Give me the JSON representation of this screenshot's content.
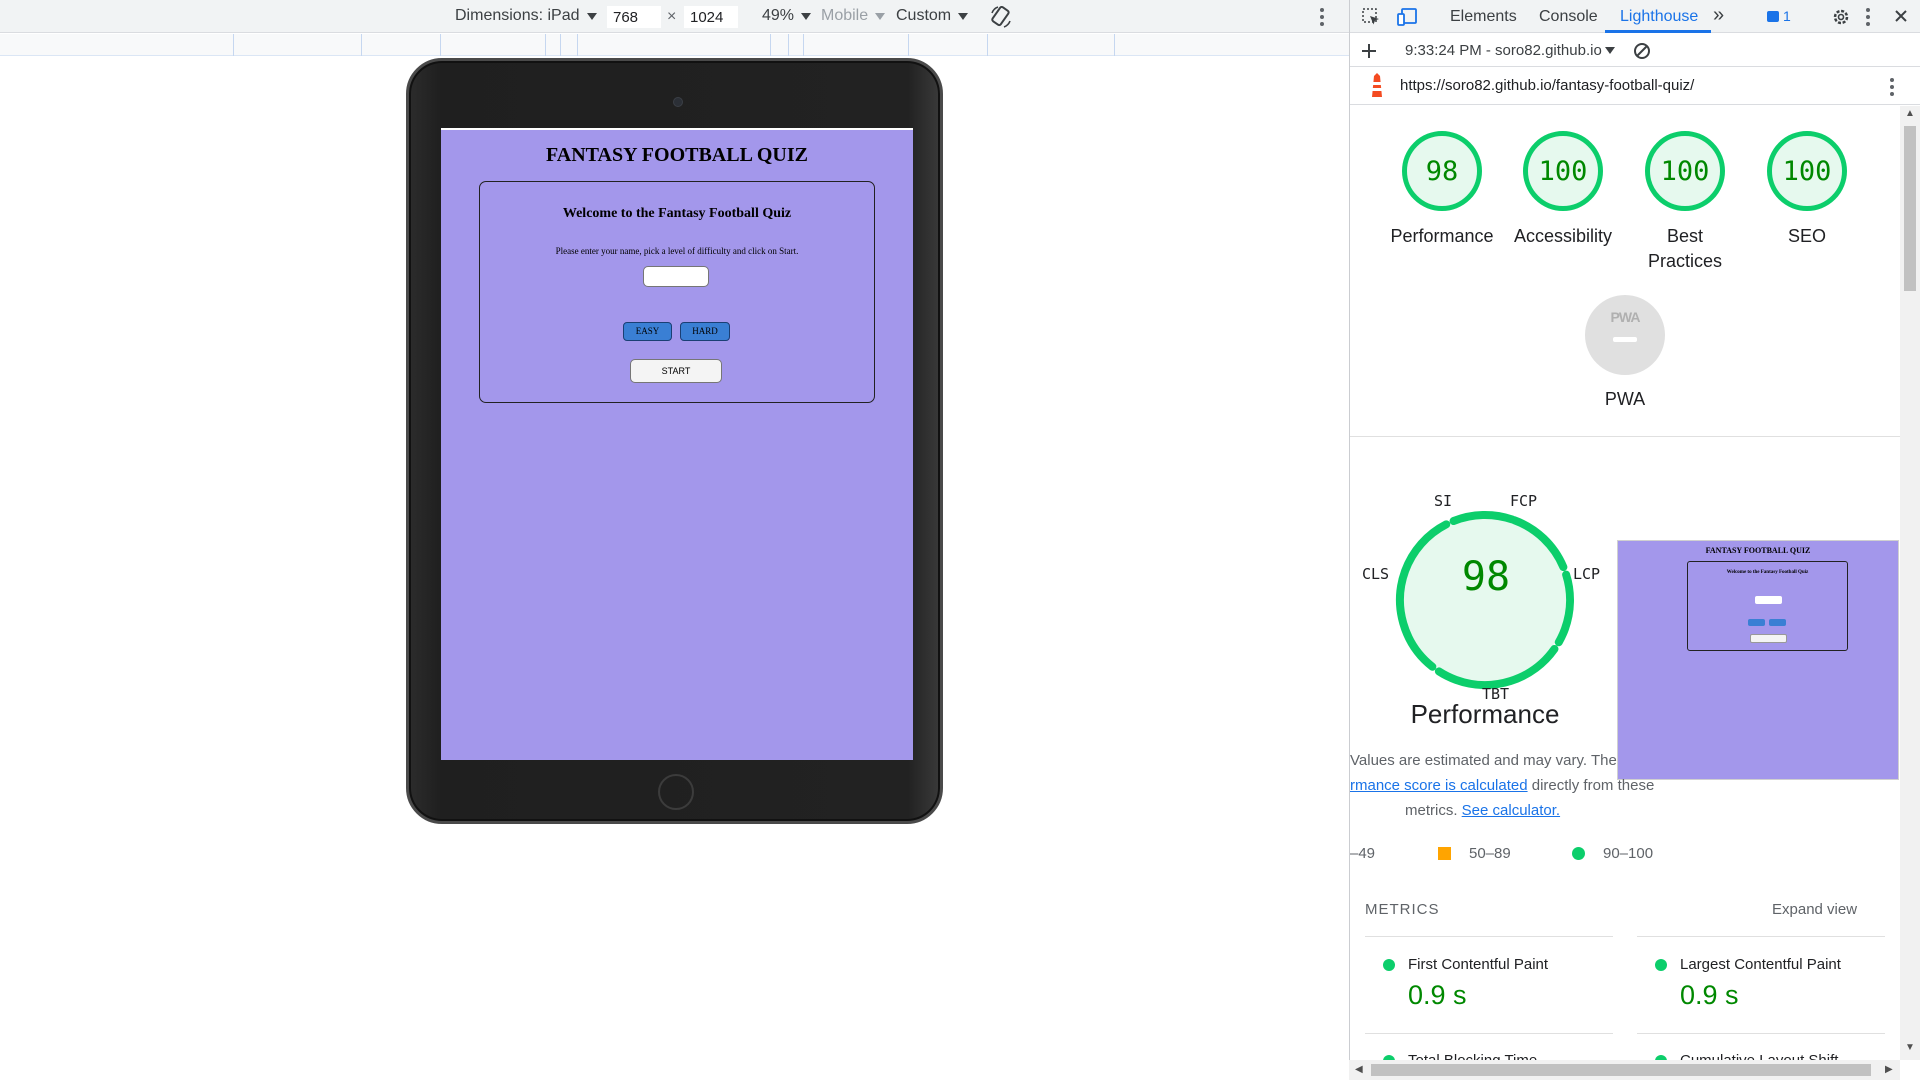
{
  "toolbar": {
    "dimensions_label": "Dimensions: iPad",
    "width": "768",
    "height": "1024",
    "times": "×",
    "zoom": "49%",
    "mode": "Mobile",
    "throttle": "Custom"
  },
  "ipad": {
    "quiz_title": "FANTASY FOOTBALL QUIZ",
    "welcome": "Welcome to the Fantasy Football Quiz",
    "instructions": "Please enter your name, pick a level of difficulty and click on Start.",
    "easy": "EASY",
    "hard": "HARD",
    "start": "START",
    "bg_color": "#a397eb"
  },
  "devtools": {
    "tabs": [
      "Elements",
      "Console",
      "Lighthouse"
    ],
    "active_tab": "Lighthouse",
    "issues_count": "1",
    "report_time": "9:33:24 PM - soro82.github.io",
    "url": "https://soro82.github.io/fantasy-football-quiz/"
  },
  "scores": {
    "performance": {
      "value": "98",
      "label": "Performance"
    },
    "accessibility": {
      "value": "100",
      "label": "Accessibility"
    },
    "best_practices": {
      "value": "100",
      "label1": "Best",
      "label2": "Practices"
    },
    "seo": {
      "value": "100",
      "label": "SEO"
    },
    "pwa": {
      "badge": "PWA",
      "label": "PWA"
    }
  },
  "perf_section": {
    "score": "98",
    "title": "Performance",
    "gauge_labels": {
      "si": "SI",
      "fcp": "FCP",
      "cls": "CLS",
      "lcp": "LCP",
      "tbt": "TBT"
    },
    "thumb_title": "FANTASY FOOTBALL QUIZ",
    "thumb_welcome": "Welcome to the Fantasy Football Quiz",
    "calc_line1": "Values are estimated and may vary. The",
    "calc_line2_link": "rmance score is calculated",
    "calc_line2_rest": " directly from these",
    "calc_line3": "metrics.",
    "calc_line3_link": "See calculator.",
    "legend": [
      "–49",
      "50–89",
      "90–100"
    ]
  },
  "metrics": {
    "heading": "METRICS",
    "expand": "Expand view",
    "items": [
      {
        "name": "First Contentful Paint",
        "value": "0.9 s"
      },
      {
        "name": "Largest Contentful Paint",
        "value": "0.9 s"
      }
    ],
    "next_items": [
      "Total Blocking Time",
      "Cumulative Layout Shift"
    ]
  },
  "colors": {
    "pass": "#0cce6b",
    "pass_text": "#008800",
    "average": "#ffa400",
    "accent": "#1a73e8"
  }
}
